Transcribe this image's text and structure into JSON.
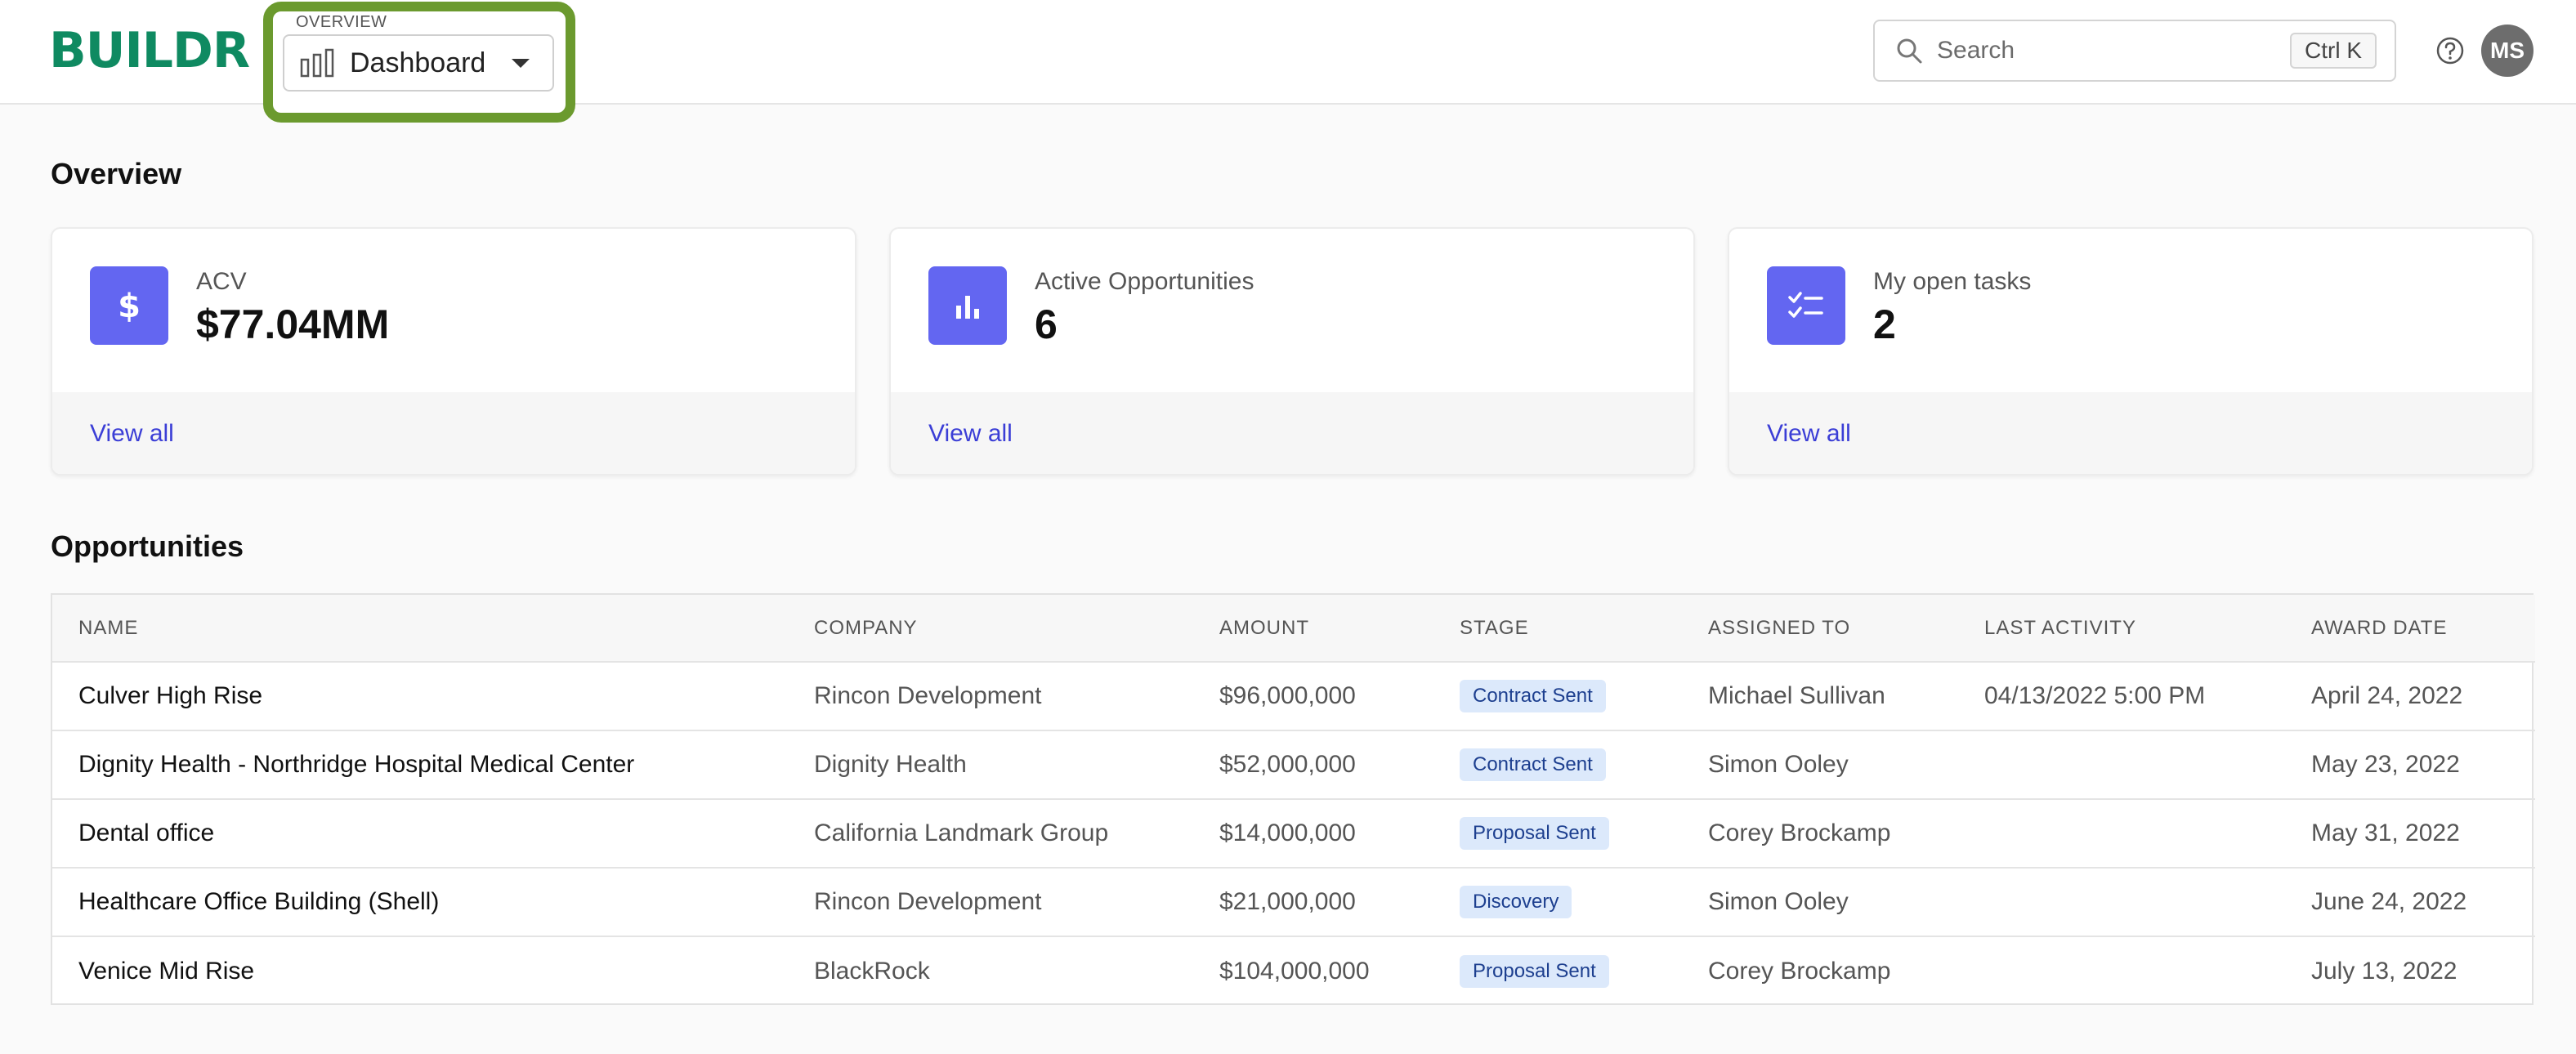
{
  "header": {
    "logo": "BUILDR",
    "switcher_caption": "OVERVIEW",
    "switcher_label": "Dashboard",
    "search_placeholder": "Search",
    "search_shortcut": "Ctrl K",
    "avatar_initials": "MS"
  },
  "colors": {
    "brand": "#0f8a61",
    "accent": "#6366f1",
    "link": "#3b3ed6",
    "highlight": "#6b9a2e",
    "badge_bg": "#dce9fb"
  },
  "overview": {
    "title": "Overview",
    "cards": [
      {
        "icon": "dollar-icon",
        "label": "ACV",
        "value": "$77.04MM",
        "link": "View all"
      },
      {
        "icon": "bar-chart-icon",
        "label": "Active Opportunities",
        "value": "6",
        "link": "View all"
      },
      {
        "icon": "checklist-icon",
        "label": "My open tasks",
        "value": "2",
        "link": "View all"
      }
    ]
  },
  "opportunities": {
    "title": "Opportunities",
    "columns": [
      "NAME",
      "COMPANY",
      "AMOUNT",
      "STAGE",
      "ASSIGNED TO",
      "LAST ACTIVITY",
      "AWARD DATE"
    ],
    "rows": [
      {
        "name": "Culver High Rise",
        "company": "Rincon Development",
        "amount": "$96,000,000",
        "stage": "Contract Sent",
        "assigned": "Michael Sullivan",
        "last_activity": "04/13/2022 5:00 PM",
        "award_date": "April 24, 2022"
      },
      {
        "name": "Dignity Health - Northridge Hospital Medical Center",
        "company": "Dignity Health",
        "amount": "$52,000,000",
        "stage": "Contract Sent",
        "assigned": "Simon Ooley",
        "last_activity": "",
        "award_date": "May 23, 2022"
      },
      {
        "name": "Dental office",
        "company": "California Landmark Group",
        "amount": "$14,000,000",
        "stage": "Proposal Sent",
        "assigned": "Corey Brockamp",
        "last_activity": "",
        "award_date": "May 31, 2022"
      },
      {
        "name": "Healthcare Office Building (Shell)",
        "company": "Rincon Development",
        "amount": "$21,000,000",
        "stage": "Discovery",
        "assigned": "Simon Ooley",
        "last_activity": "",
        "award_date": "June 24, 2022"
      },
      {
        "name": "Venice Mid Rise",
        "company": "BlackRock",
        "amount": "$104,000,000",
        "stage": "Proposal Sent",
        "assigned": "Corey Brockamp",
        "last_activity": "",
        "award_date": "July 13, 2022"
      }
    ]
  }
}
